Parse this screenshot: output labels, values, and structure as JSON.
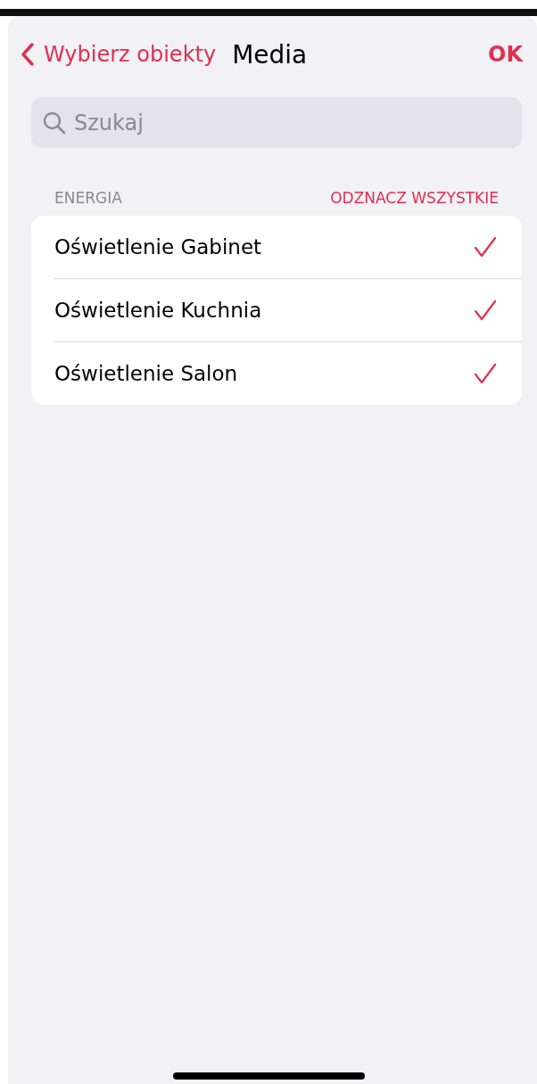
{
  "nav": {
    "back_label": "Wybierz obiekty",
    "title": "Media",
    "action": "OK"
  },
  "search": {
    "placeholder": "Szukaj"
  },
  "section": {
    "title": "ENERGIA",
    "action": "ODZNACZ WSZYSTKIE",
    "items": [
      {
        "label": "Oświetlenie Gabinet",
        "checked": true
      },
      {
        "label": "Oświetlenie Kuchnia",
        "checked": true
      },
      {
        "label": "Oświetlenie Salon",
        "checked": true
      }
    ]
  }
}
